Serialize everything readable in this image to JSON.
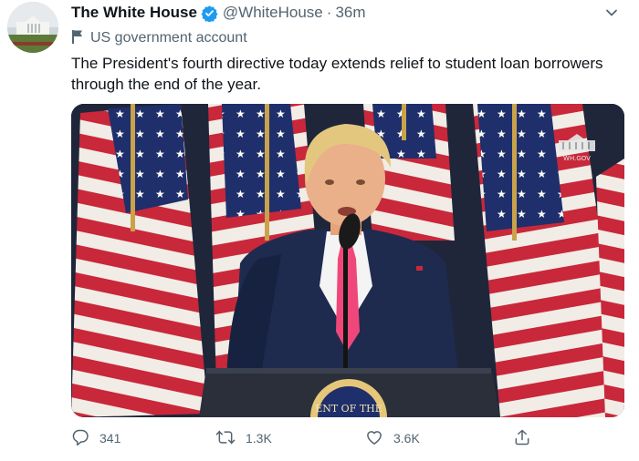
{
  "tweet": {
    "display_name": "The White House",
    "handle": "@WhiteHouse",
    "separator": "·",
    "time": "36m",
    "account_label": "US government account",
    "text": "The President's fourth directive today extends relief to student loan borrowers through the end of the year.",
    "media": {
      "watermark": "WH.GOV",
      "podium_seal_text": "ENT OF THE"
    },
    "actions": {
      "replies": "341",
      "retweets": "1.3K",
      "likes": "3.6K"
    }
  },
  "icons": {
    "verified": "verified-badge-icon",
    "flag": "flag-icon",
    "more": "more-icon",
    "reply": "reply-icon",
    "retweet": "retweet-icon",
    "like": "like-icon",
    "share": "share-icon"
  },
  "colors": {
    "verified_blue": "#1d9bf0",
    "secondary_text": "#536471",
    "primary_text": "#0f1419"
  }
}
